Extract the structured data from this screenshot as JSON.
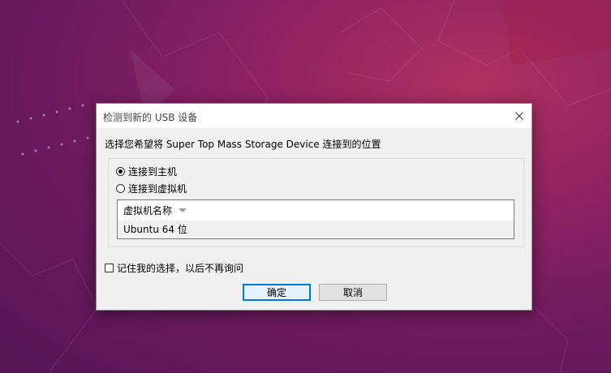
{
  "dialog": {
    "title": "检测到新的 USB 设备",
    "prompt": "选择您希望将 Super Top Mass Storage Device 连接到的位置",
    "options": {
      "host_label": "连接到主机",
      "vm_label": "连接到虚拟机",
      "selected": "host"
    },
    "vm_list": {
      "column_header": "虚拟机名称",
      "items": [
        "Ubuntu 64 位"
      ]
    },
    "remember_label": "记住我的选择，以后不再询问",
    "remember_checked": false,
    "ok_label": "确定",
    "cancel_label": "取消"
  },
  "icons": {
    "close": "close-icon",
    "sort": "sort-down-icon"
  },
  "colors": {
    "accent": "#0078d7",
    "desktop": "#8e2263"
  }
}
